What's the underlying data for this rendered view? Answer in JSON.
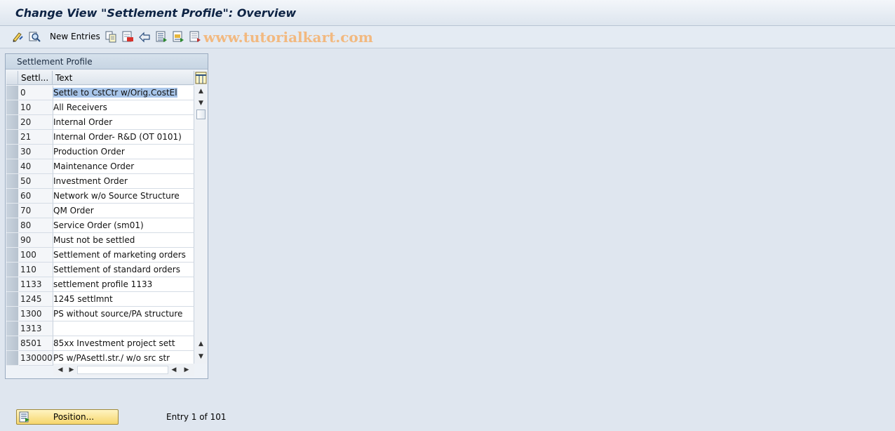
{
  "window": {
    "title": "Change View \"Settlement Profile\": Overview"
  },
  "toolbar": {
    "new_entries_label": "New Entries",
    "watermark": "www.tutorialkart.com",
    "icons": [
      "display-change-icon",
      "details-icon",
      "copy-icon",
      "delete-icon",
      "undo-icon",
      "select-all-icon",
      "select-block-icon",
      "deselect-all-icon"
    ]
  },
  "panel": {
    "title": "Settlement Profile",
    "columns": [
      "Settl...",
      "Text"
    ],
    "rows": [
      {
        "id": "0",
        "text": "Settle to CstCtr w/Orig.CostEl"
      },
      {
        "id": "10",
        "text": "All Receivers"
      },
      {
        "id": "20",
        "text": "Internal Order"
      },
      {
        "id": "21",
        "text": "Internal Order- R&D (OT 0101)"
      },
      {
        "id": "30",
        "text": "Production Order"
      },
      {
        "id": "40",
        "text": "Maintenance Order"
      },
      {
        "id": "50",
        "text": "Investment Order"
      },
      {
        "id": "60",
        "text": "Network w/o Source Structure"
      },
      {
        "id": "70",
        "text": "QM Order"
      },
      {
        "id": "80",
        "text": "Service Order (sm01)"
      },
      {
        "id": "90",
        "text": "Must not be settled"
      },
      {
        "id": "100",
        "text": "Settlement of marketing orders"
      },
      {
        "id": "110",
        "text": "Settlement of standard orders"
      },
      {
        "id": "1133",
        "text": "settlement profile 1133"
      },
      {
        "id": "1245",
        "text": "1245 settlmnt"
      },
      {
        "id": "1300",
        "text": "PS without source/PA structure"
      },
      {
        "id": "1313",
        "text": ""
      },
      {
        "id": "8501",
        "text": "85xx Investment project sett"
      },
      {
        "id": "130000",
        "text": "PS w/PAsettl.str./ w/o src str"
      }
    ]
  },
  "footer": {
    "position_button": "Position...",
    "entry_text": "Entry 1 of 101"
  },
  "colors": {
    "background": "#dfe6ef",
    "title_text": "#0d2344",
    "button_yellow": "#f6d66c",
    "selection": "#a9c6ea"
  }
}
